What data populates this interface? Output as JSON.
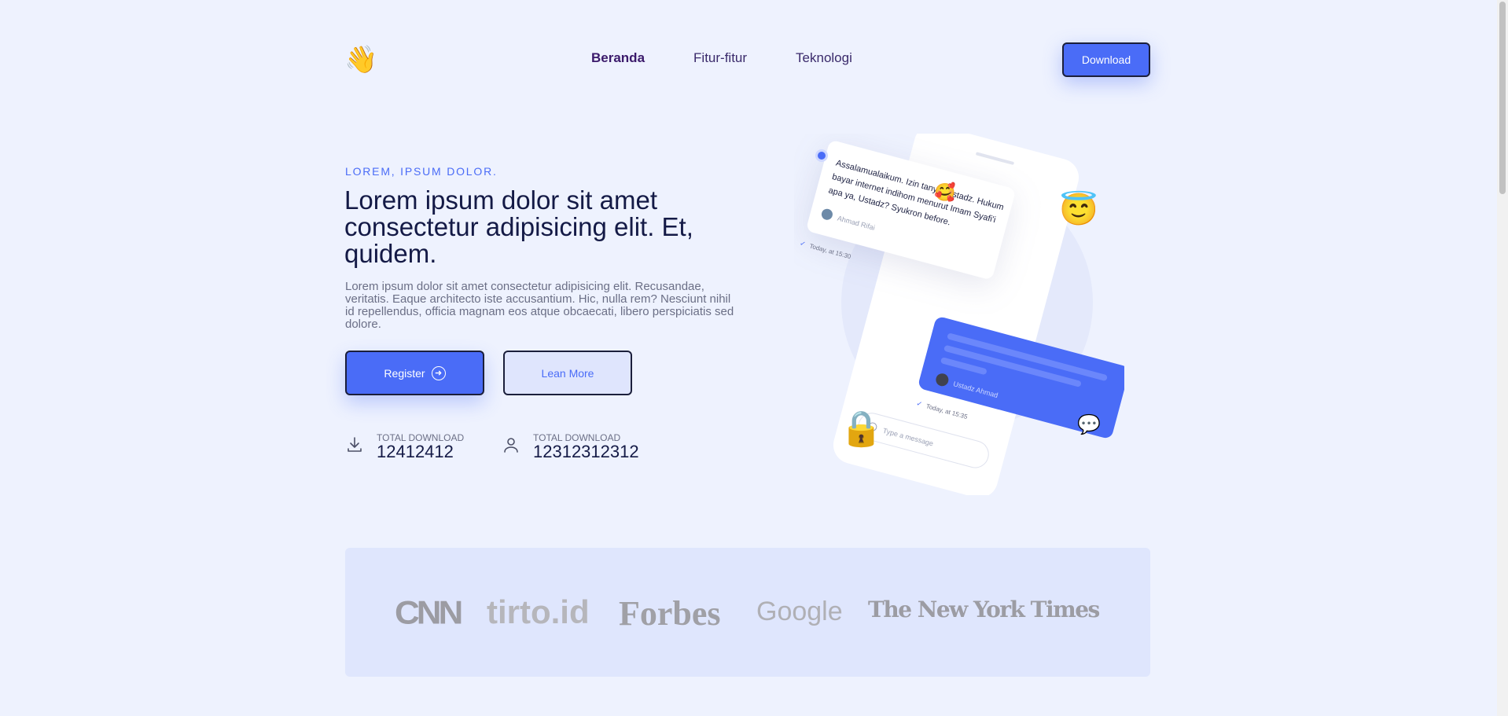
{
  "header": {
    "logo_emoji": "👋",
    "nav": [
      {
        "label": "Beranda",
        "active": true
      },
      {
        "label": "Fitur-fitur",
        "active": false
      },
      {
        "label": "Teknologi",
        "active": false
      }
    ],
    "download_label": "Download"
  },
  "hero": {
    "eyebrow": "LOREM, IPSUM DOLOR.",
    "headline": "Lorem ipsum dolor sit amet consectetur adipisicing elit. Et, quidem.",
    "description": "Lorem ipsum dolor sit amet consectetur adipisicing elit. Recusandae, veritatis. Eaque architecto iste accusantium. Hic, nulla rem? Nesciunt nihil id repellendus, officia magnam eos atque obcaecati, libero perspiciatis sed dolore.",
    "register_label": "Register",
    "learn_more_label": "Lean More"
  },
  "stats": [
    {
      "label": "TOTAL DOWNLOAD",
      "value": "12412412",
      "icon": "download-icon"
    },
    {
      "label": "TOTAL DOWNLOAD",
      "value": "12312312312",
      "icon": "user-icon"
    }
  ],
  "chat": {
    "message1": [
      "Assalamualaikum. Izin tanya, Ustadz. Hukum",
      "bayar internet indihom menurut Imam Syafi'i",
      "apa ya, Ustadz? Syukron before."
    ],
    "sender1": "Ahmad Rifai",
    "time1": "Today, at 15:30",
    "sender2": "Ustadz Ahmad",
    "time2": "Today, at 15:35",
    "input_placeholder": "Type a message",
    "emoji_love": "🥰",
    "emoji_angel": "😇",
    "emoji_lock": "🔒",
    "emoji_chat": "💬"
  },
  "brands": [
    "CNN",
    "tirto.id",
    "Forbes",
    "Google",
    "The New York Times"
  ],
  "colors": {
    "accent": "#4a6cf7",
    "background": "#eef2fe",
    "brand_panel": "#dfe6fd"
  }
}
